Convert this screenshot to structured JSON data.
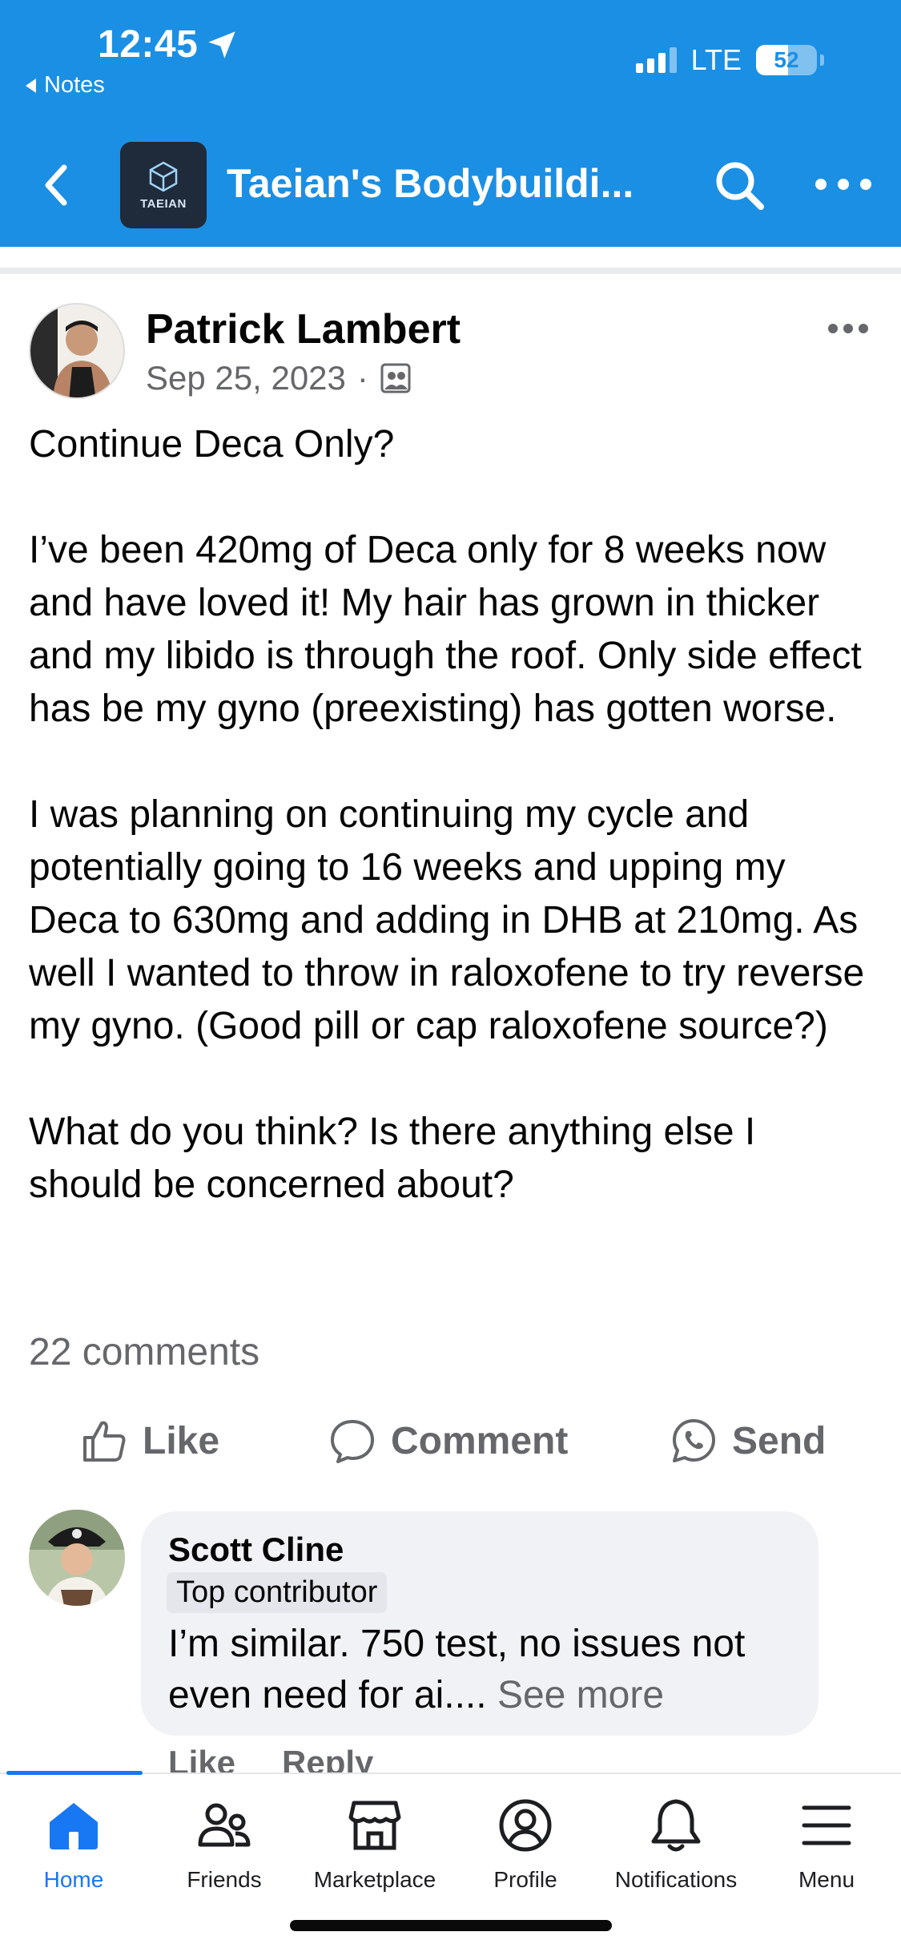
{
  "status_bar": {
    "time": "12:45",
    "back_app": "Notes",
    "network": "LTE",
    "battery": "52"
  },
  "header": {
    "group_logo_text": "TAEIAN",
    "group_title": "Taeian's Bodybuildi..."
  },
  "post": {
    "author": "Patrick Lambert",
    "date": "Sep 25, 2023",
    "paragraphs": [
      "Continue Deca Only?",
      "I’ve been 420mg of Deca only for 8 weeks now and have loved it! My hair has grown in thicker and my libido is through the roof. Only side effect has be my gyno (preexisting) has gotten worse.",
      "I was planning on continuing my cycle and potentially going to 16 weeks and upping my Deca to 630mg and adding in DHB at 210mg. As well I wanted to throw in raloxofene to try reverse my gyno. (Good pill or cap raloxofene source?)",
      "What do you think? Is there anything else I should be concerned about?"
    ],
    "comments_count": "22 comments",
    "actions": {
      "like": "Like",
      "comment": "Comment",
      "send": "Send"
    }
  },
  "comment": {
    "author": "Scott Cline",
    "badge": "Top contributor",
    "text": "I’m similar. 750 test, no issues not even need for ai.... ",
    "see_more": "See more",
    "like": "Like",
    "reply": "Reply"
  },
  "tabbar": {
    "items": [
      {
        "label": "Home",
        "icon": "home-icon",
        "active": true
      },
      {
        "label": "Friends",
        "icon": "friends-icon"
      },
      {
        "label": "Marketplace",
        "icon": "marketplace-icon"
      },
      {
        "label": "Profile",
        "icon": "profile-icon"
      },
      {
        "label": "Notifications",
        "icon": "bell-icon"
      },
      {
        "label": "Menu",
        "icon": "menu-icon"
      }
    ]
  },
  "colors": {
    "header_blue": "#1b8fe3",
    "accent": "#1877f2",
    "secondary_text": "#65676b"
  }
}
